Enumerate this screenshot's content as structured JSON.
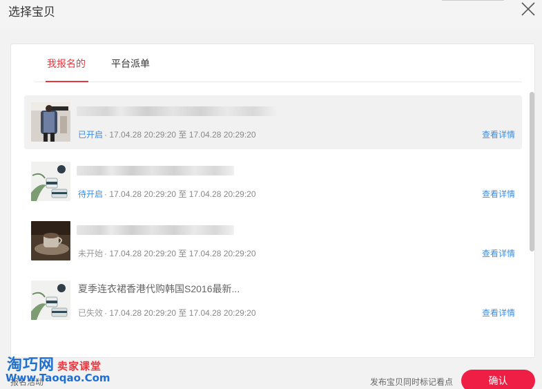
{
  "dialog": {
    "title": "选择宝贝"
  },
  "tabs": [
    {
      "label": "我报名的",
      "active": true
    },
    {
      "label": "平台派单",
      "active": false
    }
  ],
  "items": [
    {
      "title": "",
      "status": "已开启",
      "status_color": "#3a8ee6",
      "time": "· 17.04.28  20:29:20 至 17.04.28  20:29:20",
      "detail": "查看详情"
    },
    {
      "title": "",
      "status": "待开启",
      "status_color": "#3a8ee6",
      "time": "· 17.04.28  20:29:20 至 17.04.28  20:29:20",
      "detail": "查看详情"
    },
    {
      "title": "",
      "status": "未开始",
      "status_color": "#999999",
      "time": "· 17.04.28  20:29:20 至 17.04.28  20:29:20",
      "detail": "查看详情"
    },
    {
      "title": "夏季连衣裙香港代购韩国S2016最新...",
      "status": "已失效",
      "status_color": "#999999",
      "time": "· 17.04.28  20:29:20 至 17.04.28  20:29:20",
      "detail": "查看详情"
    }
  ],
  "footer": {
    "left_text": "报名活动",
    "hint": "发布宝贝同时标记看点",
    "confirm_label": "确认"
  },
  "watermark": {
    "line1": "淘巧网",
    "line1_sub": "卖家课堂",
    "line2": "Www.Taoqao.Com"
  },
  "colors": {
    "accent": "#e8363f",
    "link": "#3a8ee6",
    "confirm": "#ee1e45"
  }
}
